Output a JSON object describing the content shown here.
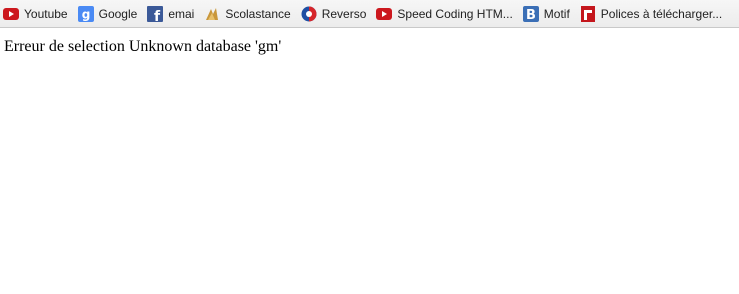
{
  "bookmarks": [
    {
      "label": "Youtube",
      "icon": "youtube-icon"
    },
    {
      "label": "Google",
      "icon": "google-icon"
    },
    {
      "label": "emai",
      "icon": "facebook-icon"
    },
    {
      "label": "Scolastance",
      "icon": "scolastance-icon"
    },
    {
      "label": "Reverso",
      "icon": "reverso-icon"
    },
    {
      "label": "Speed Coding HTM...",
      "icon": "youtube-icon"
    },
    {
      "label": "Motif",
      "icon": "b-icon"
    },
    {
      "label": "Polices à télécharger...",
      "icon": "polices-icon"
    }
  ],
  "page": {
    "message": "Erreur de selection Unknown database 'gm'"
  },
  "colors": {
    "youtube": "#cc181e",
    "google": "#4a8af4",
    "facebook": "#3b5998",
    "reverso_red": "#d6262b",
    "reverso_blue": "#1f4fa3",
    "b_icon": "#3b6fb6",
    "polices": "#c4161c"
  }
}
